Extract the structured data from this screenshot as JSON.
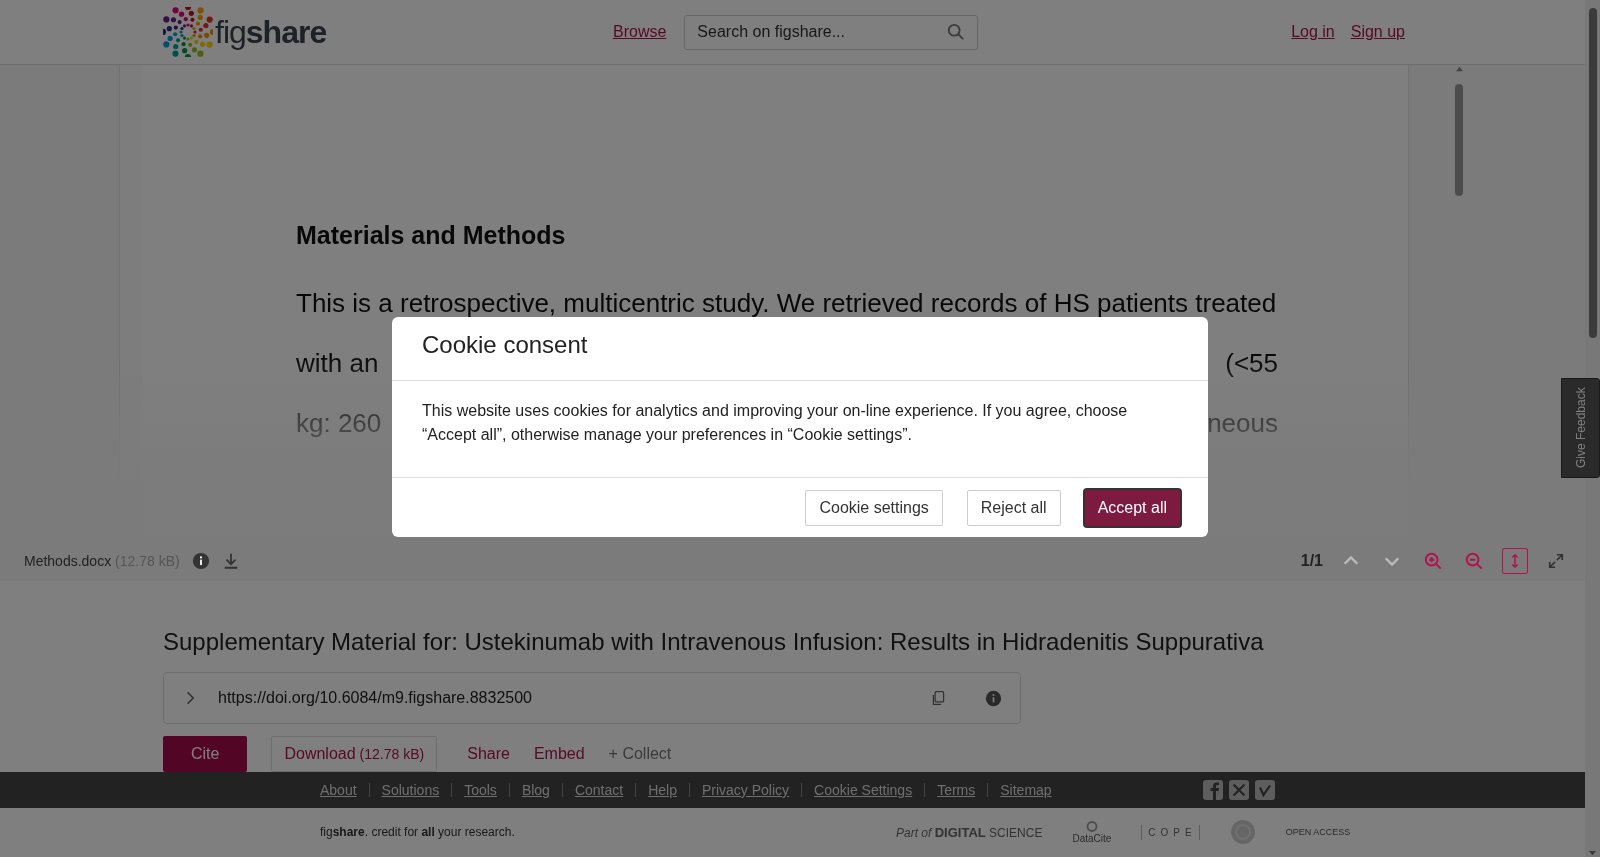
{
  "header": {
    "logo": "fig**share**",
    "nav": [
      {
        "label": "Browse"
      }
    ],
    "search": {
      "placeholder": "Search on figshare..."
    },
    "auth_links": [
      {
        "label": "Log in"
      },
      {
        "label": "Sign up"
      }
    ]
  },
  "viewer": {
    "heading": "Materials and Methods",
    "lines": [
      {
        "kind": "full",
        "text": "This is a retrospective, multicentric study. We retrieved records of HS patients treated"
      },
      {
        "kind": "split",
        "left": "with an",
        "right": "(<55"
      },
      {
        "kind": "split",
        "left": "kg: 260",
        "right": "neous"
      }
    ],
    "file_name": "Methods.docx",
    "file_size": "(12.78 kB)",
    "page": "1/1",
    "tools": [
      {
        "kind": "prev",
        "disabled": true,
        "selected": false
      },
      {
        "kind": "next",
        "disabled": true,
        "selected": false
      },
      {
        "kind": "zoom-in",
        "disabled": false,
        "selected": false
      },
      {
        "kind": "zoom-out",
        "disabled": false,
        "selected": false
      },
      {
        "kind": "fit-height",
        "disabled": false,
        "selected": true
      },
      {
        "kind": "fullscreen",
        "disabled": false,
        "selected": false
      }
    ]
  },
  "item": {
    "title": "Supplementary Material for: Ustekinumab with Intravenous Infusion: Results in Hidradenitis Suppurativa",
    "doi": "https://doi.org/10.6084/m9.figshare.8832500",
    "actions": [
      {
        "kind": "primary",
        "label": "Cite"
      },
      {
        "kind": "outline",
        "label": "Download",
        "note": "(12.78 kB)"
      },
      {
        "kind": "link",
        "label": "Share"
      },
      {
        "kind": "link",
        "label": "Embed"
      },
      {
        "kind": "muted",
        "label": "+ Collect"
      }
    ]
  },
  "footer": {
    "links": [
      "About",
      "Solutions",
      "Tools",
      "Blog",
      "Contact",
      "Help",
      "Privacy Policy",
      "Cookie Settings",
      "Terms",
      "Sitemap"
    ],
    "tagline": "fig**share**. credit for **all** your research.",
    "partners": [
      {
        "kind": "digital-science",
        "label": "*Part of* **DIGITAL** SCIENCE"
      },
      {
        "kind": "datacite",
        "label": "DataCite"
      },
      {
        "kind": "cope",
        "label": "COPE"
      },
      {
        "kind": "seal"
      },
      {
        "kind": "open-access",
        "label": "OPEN ACCESS"
      }
    ]
  },
  "modal": {
    "title": "Cookie consent",
    "body": "This website uses cookies for analytics and improving your on-line experience. If you agree, choose “Accept all”, otherwise manage your preferences in “Cookie settings”.",
    "buttons": [
      {
        "kind": "secondary",
        "label": "Cookie settings"
      },
      {
        "kind": "secondary",
        "label": "Reject all"
      },
      {
        "kind": "primary",
        "label": "Accept all"
      }
    ]
  },
  "feedback": {
    "label": "Give Feedback"
  }
}
